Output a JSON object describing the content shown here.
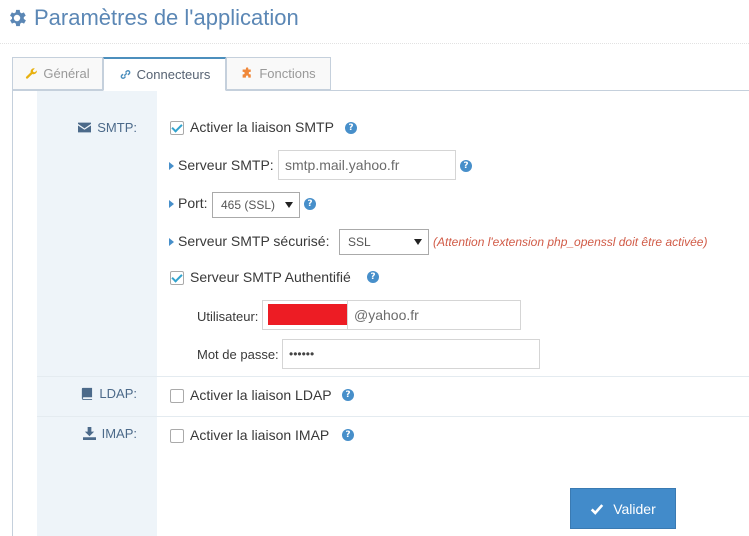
{
  "page": {
    "title": "Paramètres de l'application"
  },
  "tabs": [
    {
      "label": "Général",
      "icon": "wrench-icon"
    },
    {
      "label": "Connecteurs",
      "icon": "link-icon",
      "active": true
    },
    {
      "label": "Fonctions",
      "icon": "puzzle-icon"
    }
  ],
  "smtp": {
    "section_label": "SMTP:",
    "enable_label": "Activer la liaison SMTP",
    "enable_checked": true,
    "server_label": "Serveur SMTP:",
    "server_value": "smtp.mail.yahoo.fr",
    "port_label": "Port:",
    "port_value": "465 (SSL)",
    "secure_label": "Serveur SMTP sécurisé:",
    "secure_value": "SSL",
    "secure_warning": "(Attention l'extension php_openssl doit être activée)",
    "auth_label": "Serveur SMTP Authentifié",
    "auth_checked": true,
    "user_label": "Utilisateur:",
    "user_suffix": "@yahoo.fr",
    "password_label": "Mot de passe:",
    "password_value": "••••••"
  },
  "ldap": {
    "section_label": "LDAP:",
    "enable_label": "Activer la liaison LDAP",
    "enable_checked": false
  },
  "imap": {
    "section_label": "IMAP:",
    "enable_label": "Activer la liaison IMAP",
    "enable_checked": false
  },
  "actions": {
    "submit_label": "Valider"
  },
  "colors": {
    "accent": "#428bca",
    "title": "#5b87b5",
    "warning": "#d15b47",
    "label_bg": "#eef4f9"
  }
}
